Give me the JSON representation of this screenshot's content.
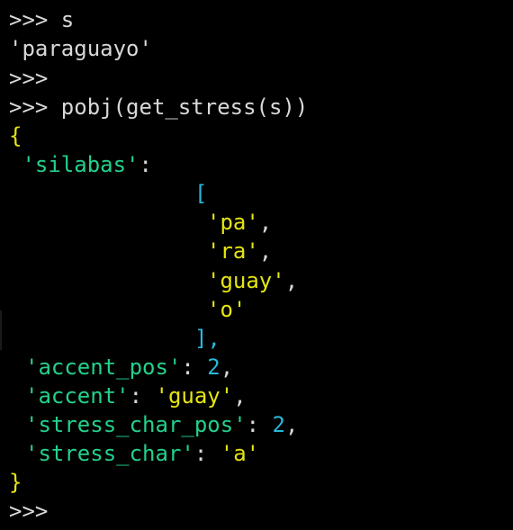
{
  "terminal": {
    "lines": [
      {
        "prompt": ">>> ",
        "text": "s"
      },
      {
        "text": "'paraguayo'"
      },
      {
        "prompt": ">>>"
      },
      {
        "prompt": ">>> ",
        "text": "pobj(get_stress(s))"
      }
    ],
    "dict": {
      "open_brace": "{",
      "close_brace": "}",
      "silabas_key": "'silabas'",
      "silabas_colon": ":",
      "list_open": "[",
      "list_close": "],",
      "items": [
        "'pa'",
        "'ra'",
        "'guay'",
        "'o'"
      ],
      "item_comma": ",",
      "accent_pos_key": "'accent_pos'",
      "accent_pos_value": "2",
      "accent_key": "'accent'",
      "accent_value": "'guay'",
      "stress_char_pos_key": "'stress_char_pos'",
      "stress_char_pos_value": "2",
      "stress_char_key": "'stress_char'",
      "stress_char_value": "'a'",
      "colon_space": ": ",
      "comma": ","
    },
    "final_prompt": ">>>"
  }
}
